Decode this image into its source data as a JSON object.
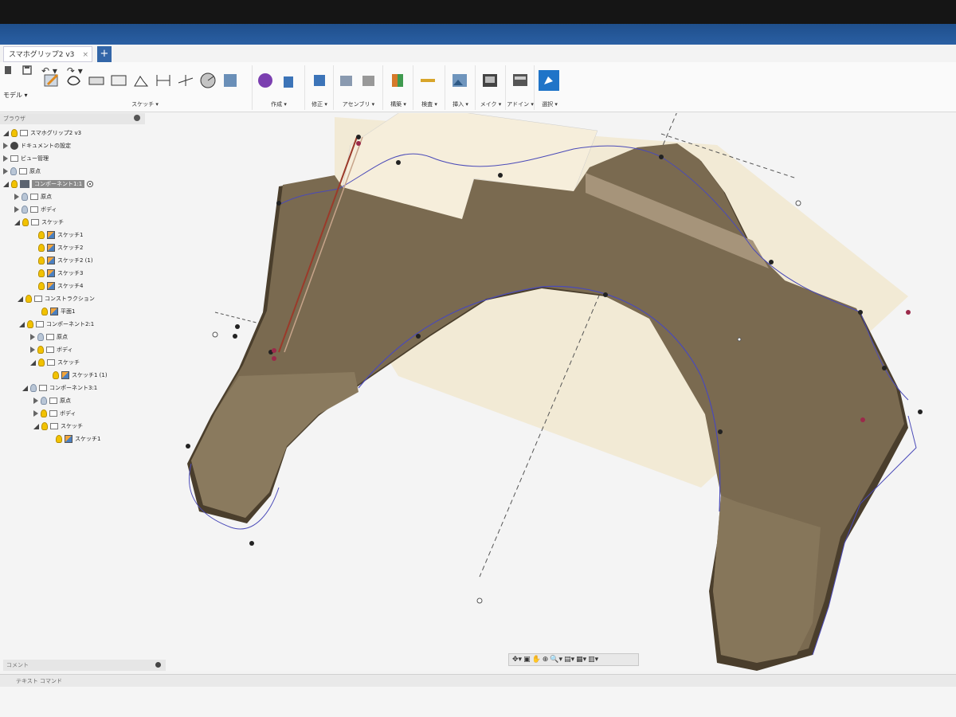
{
  "document": {
    "tab_title": "スマホグリップ2 v3",
    "tab_close": "×",
    "tab_add": "+"
  },
  "quick_access": {
    "file_icon": "file-icon",
    "save_icon": "save-icon",
    "undo": "↶ ▾",
    "redo": "↷ ▾"
  },
  "workspace": {
    "label": "モデル ▾"
  },
  "toolbar_groups": [
    {
      "label": "スケッチ ▾"
    },
    {
      "label": "作成 ▾"
    },
    {
      "label": "修正 ▾"
    },
    {
      "label": "アセンブリ ▾"
    },
    {
      "label": "構築 ▾"
    },
    {
      "label": "検査 ▾"
    },
    {
      "label": "挿入 ▾"
    },
    {
      "label": "メイク ▾"
    },
    {
      "label": "アドイン ▾"
    },
    {
      "label": "選択 ▾"
    }
  ],
  "browser": {
    "header": "ブラウザ",
    "items": [
      {
        "label": "スマホグリップ2 v3"
      },
      {
        "label": "ドキュメントの設定"
      },
      {
        "label": "ビュー管理"
      },
      {
        "label": "原点"
      },
      {
        "label": "コンポーネント1:1"
      },
      {
        "label": "原点"
      },
      {
        "label": "ボディ"
      },
      {
        "label": "スケッチ"
      },
      {
        "label": "スケッチ1"
      },
      {
        "label": "スケッチ2"
      },
      {
        "label": "スケッチ2 (1)"
      },
      {
        "label": "スケッチ3"
      },
      {
        "label": "スケッチ4"
      },
      {
        "label": "コンストラクション"
      },
      {
        "label": "平面1"
      },
      {
        "label": "コンポーネント2:1"
      },
      {
        "label": "原点"
      },
      {
        "label": "ボディ"
      },
      {
        "label": "スケッチ"
      },
      {
        "label": "スケッチ1 (1)"
      },
      {
        "label": "コンポーネント3:1"
      },
      {
        "label": "原点"
      },
      {
        "label": "ボディ"
      },
      {
        "label": "スケッチ"
      },
      {
        "label": "スケッチ1"
      }
    ]
  },
  "comments": {
    "label": "コメント"
  },
  "text_command": {
    "label": "テキスト コマンド"
  },
  "colors": {
    "body": "#7a6a50",
    "body_dark": "#5a4c36",
    "sketch_plane": "#f1e7cf",
    "sketch_line": "#4a4ab8",
    "accent": "#2a5fa3"
  }
}
